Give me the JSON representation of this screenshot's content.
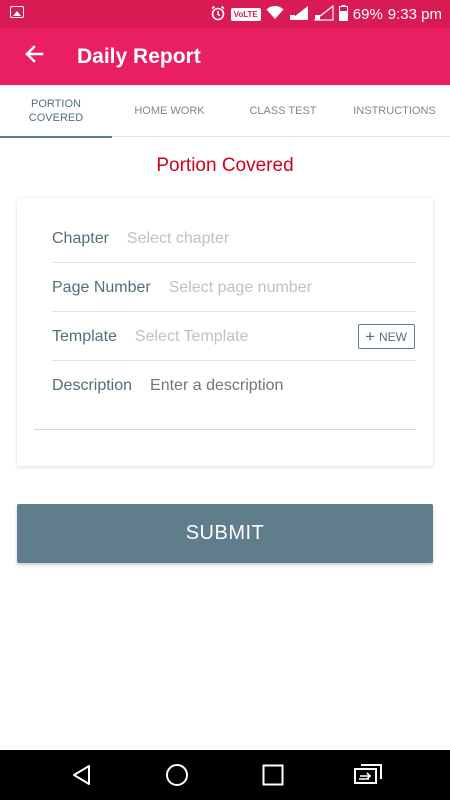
{
  "status_bar": {
    "volte": "VoLTE",
    "battery_percent": "69%",
    "time": "9:33 pm",
    "icons": [
      "image-icon",
      "alarm-icon",
      "volte-icon",
      "wifi-icon",
      "signal-icon",
      "signal-icon",
      "battery-icon"
    ]
  },
  "app_bar": {
    "title": "Daily Report",
    "back_icon": "arrow-back-icon",
    "background": "#e91e63"
  },
  "tabs": [
    {
      "label": "PORTION\nCOVERED",
      "line1": "PORTION",
      "line2": "COVERED",
      "active": true
    },
    {
      "label": "HOME WORK",
      "active": false
    },
    {
      "label": "CLASS TEST",
      "active": false
    },
    {
      "label": "INSTRUCTIONS",
      "active": false
    }
  ],
  "section_title": "Portion Covered",
  "form": {
    "chapter": {
      "label": "Chapter",
      "placeholder": "Select chapter"
    },
    "page_number": {
      "label": "Page Number",
      "placeholder": "Select page number"
    },
    "template": {
      "label": "Template",
      "placeholder": "Select Template",
      "new_button": "NEW"
    },
    "description": {
      "label": "Description",
      "placeholder": "Enter a description"
    }
  },
  "submit_label": "SUBMIT",
  "colors": {
    "accent": "#e91e63",
    "title_red": "#d0021b",
    "button": "#607d8b"
  },
  "nav_bar": {
    "icons": [
      "back-triangle-icon",
      "home-circle-icon",
      "recents-square-icon",
      "switch-app-icon"
    ]
  }
}
